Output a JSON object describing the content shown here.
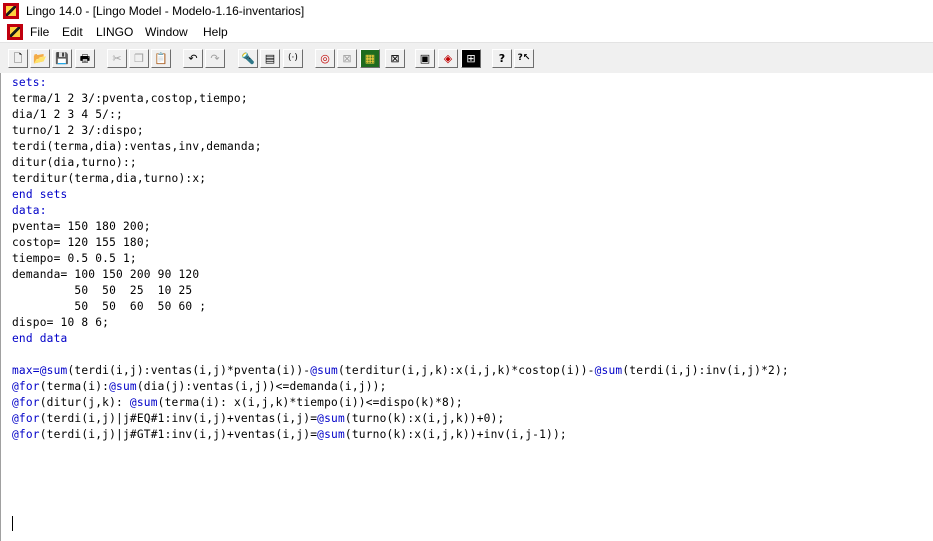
{
  "window": {
    "title": "Lingo 14.0 - [Lingo Model - Modelo-1.16-inventarios]"
  },
  "menu": {
    "items": [
      "File",
      "Edit",
      "LINGO",
      "Window",
      "Help"
    ]
  },
  "colors": {
    "keyword": "#0000c8",
    "text": "#000000",
    "toolbar_bg": "#f0f0f0"
  },
  "toolbar": {
    "buttons": [
      {
        "name": "new-icon",
        "glyph": "🗋"
      },
      {
        "name": "open-icon",
        "glyph": "📂"
      },
      {
        "name": "save-icon",
        "glyph": "💾"
      },
      {
        "name": "print-icon",
        "glyph": "🖶"
      },
      {
        "name": "cut-icon",
        "glyph": "✂"
      },
      {
        "name": "copy-icon",
        "glyph": "❐"
      },
      {
        "name": "paste-icon",
        "glyph": "📋"
      },
      {
        "name": "undo-icon",
        "glyph": "↶"
      },
      {
        "name": "redo-icon",
        "glyph": "↷"
      },
      {
        "name": "find-icon",
        "glyph": "🔦"
      },
      {
        "name": "goto-line-icon",
        "glyph": "▤"
      },
      {
        "name": "match-paren-icon",
        "glyph": "(·)"
      },
      {
        "name": "solve-icon",
        "glyph": "◎"
      },
      {
        "name": "solution-icon",
        "glyph": "⊠"
      },
      {
        "name": "matrix-picture-icon",
        "glyph": "▦"
      },
      {
        "name": "close-all-icon",
        "glyph": "⊠"
      },
      {
        "name": "options-icon",
        "glyph": "▣"
      },
      {
        "name": "send-to-back-icon",
        "glyph": "◈"
      },
      {
        "name": "tile-icon",
        "glyph": "⊞"
      },
      {
        "name": "help-icon",
        "glyph": "?"
      },
      {
        "name": "context-help-icon",
        "glyph": "?↖"
      }
    ]
  },
  "code": [
    [
      {
        "t": "sets:",
        "k": 1
      }
    ],
    [
      {
        "t": "terma/1 2 3/:pventa,costop,tiempo;"
      }
    ],
    [
      {
        "t": "dia/1 2 3 4 5/:;"
      }
    ],
    [
      {
        "t": "turno/1 2 3/:dispo;"
      }
    ],
    [
      {
        "t": "terdi(terma,dia):ventas,inv,demanda;"
      }
    ],
    [
      {
        "t": "ditur(dia,turno):;"
      }
    ],
    [
      {
        "t": "terditur(terma,dia,turno):x;"
      }
    ],
    [
      {
        "t": "end sets",
        "k": 1
      }
    ],
    [
      {
        "t": "data:",
        "k": 1
      }
    ],
    [
      {
        "t": "pventa= 150 180 200;"
      }
    ],
    [
      {
        "t": "costop= 120 155 180;"
      }
    ],
    [
      {
        "t": "tiempo= 0.5 0.5 1;"
      }
    ],
    [
      {
        "t": "demanda= 100 150 200 90 120"
      }
    ],
    [
      {
        "t": "         50  50  25  10 25"
      }
    ],
    [
      {
        "t": "         50  50  60  50 60 ;"
      }
    ],
    [
      {
        "t": "dispo= 10 8 6;"
      }
    ],
    [
      {
        "t": "end data",
        "k": 1
      }
    ],
    [
      {
        "t": ""
      }
    ],
    [
      {
        "t": "max=@sum",
        "k": 1
      },
      {
        "t": "(terdi(i,j):ventas(i,j)*pventa(i))-"
      },
      {
        "t": "@sum",
        "k": 1
      },
      {
        "t": "(terditur(i,j,k):x(i,j,k)*costop(i))-"
      },
      {
        "t": "@sum",
        "k": 1
      },
      {
        "t": "(terdi(i,j):inv(i,j)*2);"
      }
    ],
    [
      {
        "t": "@for",
        "k": 1
      },
      {
        "t": "(terma(i):"
      },
      {
        "t": "@sum",
        "k": 1
      },
      {
        "t": "(dia(j):ventas(i,j))<=demanda(i,j));"
      }
    ],
    [
      {
        "t": "@for",
        "k": 1
      },
      {
        "t": "(ditur(j,k): "
      },
      {
        "t": "@sum",
        "k": 1
      },
      {
        "t": "(terma(i): x(i,j,k)*tiempo(i))<=dispo(k)*8);"
      }
    ],
    [
      {
        "t": "@for",
        "k": 1
      },
      {
        "t": "(terdi(i,j)|j#EQ#1:inv(i,j)+ventas(i,j)="
      },
      {
        "t": "@sum",
        "k": 1
      },
      {
        "t": "(turno(k):x(i,j,k))+0);"
      }
    ],
    [
      {
        "t": "@for",
        "k": 1
      },
      {
        "t": "(terdi(i,j)|j#GT#1:inv(i,j)+ventas(i,j)="
      },
      {
        "t": "@sum",
        "k": 1
      },
      {
        "t": "(turno(k):x(i,j,k))+inv(i,j-1));"
      }
    ]
  ]
}
